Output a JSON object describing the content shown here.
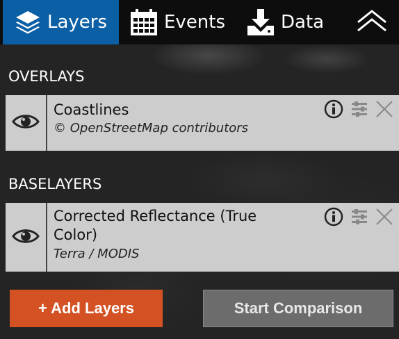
{
  "tabs": [
    {
      "label": "Layers",
      "icon": "layers-icon",
      "active": true
    },
    {
      "label": "Events",
      "icon": "calendar-icon",
      "active": false
    },
    {
      "label": "Data",
      "icon": "download-icon",
      "active": false
    }
  ],
  "overlays": {
    "title": "OVERLAYS",
    "layers": [
      {
        "name": "Coastlines",
        "attribution": "© OpenStreetMap contributors"
      }
    ]
  },
  "baselayers": {
    "title": "BASELAYERS",
    "layers": [
      {
        "name_line1": "Corrected Reflectance (True",
        "name_line2": "Color)",
        "attribution": "Terra / MODIS"
      }
    ]
  },
  "buttons": {
    "add_layers": "+ Add Layers",
    "start_comparison": "Start Comparison"
  },
  "colors": {
    "active_tab": "#0b5fa5",
    "add_button": "#d35122",
    "card_bg": "#cdcdcd"
  }
}
